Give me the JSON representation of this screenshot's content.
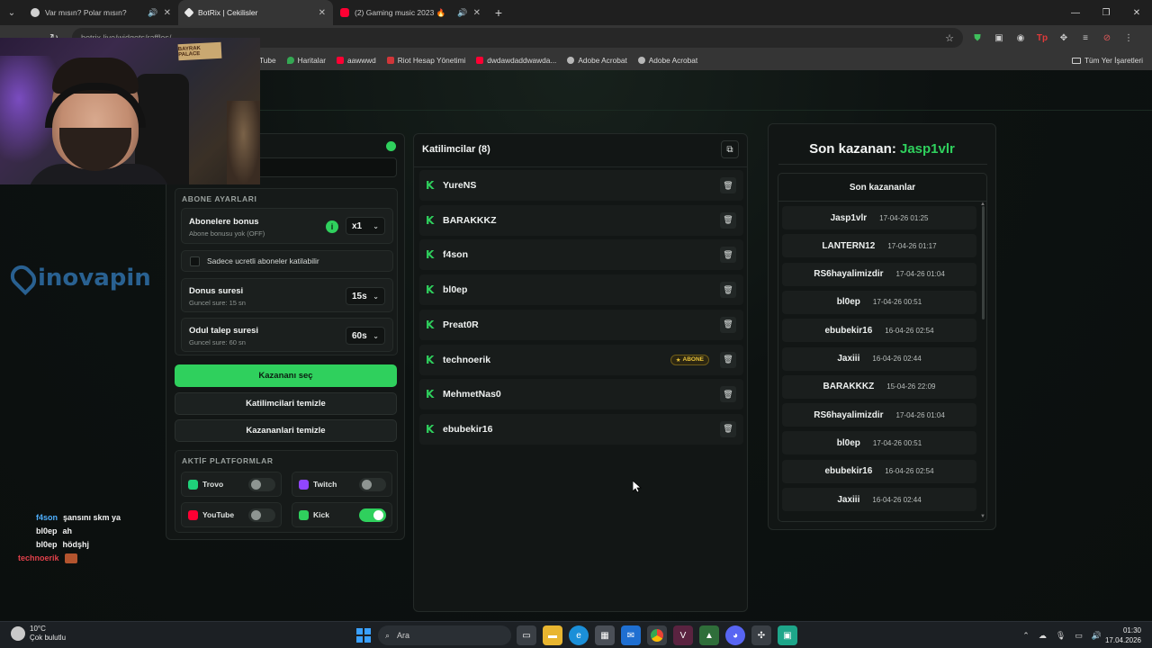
{
  "browser": {
    "tabs": [
      {
        "title": "Var mısın? Polar mısın?",
        "active": false,
        "favicon_color": "#d0d0d0"
      },
      {
        "title": "BotRix | Cekilisler",
        "active": true,
        "favicon_color": "#e8e8e8"
      },
      {
        "title": "(2) Gaming music 2023 🔥",
        "active": false,
        "favicon_color": "#ff0033"
      }
    ],
    "new_tab_icon": "+",
    "url": "botrix.live/widgets/raffles/",
    "bookmarks": [
      {
        "label": "YouTube",
        "icon_color": "#ff0033"
      },
      {
        "label": "Haritalar",
        "icon_color": "#34a853"
      },
      {
        "label": "aawwwd",
        "icon_color": "#ff0033"
      },
      {
        "label": "Riot Hesap Yönetimi",
        "icon_color": "#d13639"
      },
      {
        "label": "dwdawdaddwawda...",
        "icon_color": "#ff0033"
      },
      {
        "label": "Adobe Acrobat",
        "icon_color": "#b7b7b7"
      },
      {
        "label": "Adobe Acrobat",
        "icon_color": "#b7b7b7"
      }
    ],
    "all_bookmarks": "Tüm Yer İşaretleri"
  },
  "settings": {
    "subscriber_section": {
      "title": "ABONE AYARLARI",
      "bonus_title": "Abonelere bonus",
      "bonus_sub": "Abone bonusu yok (OFF)",
      "bonus_value": "x1",
      "only_paid_label": "Sadece ucretli aboneler katilabilir",
      "duration_title": "Donus suresi",
      "duration_sub": "Guncel sure: 15 sn",
      "duration_value": "15s",
      "claim_title": "Odul talep suresi",
      "claim_sub": "Guncel sure: 60 sn",
      "claim_value": "60s"
    },
    "buttons": {
      "pick_winner": "Kazananı seç",
      "clear_participants": "Katilimcilari temizle",
      "clear_winners": "Kazananlari temizle"
    },
    "platforms": {
      "title": "AKTİF PLATFORMLAR",
      "items": [
        {
          "name": "Trovo",
          "enabled": false,
          "color": "#1fd17a"
        },
        {
          "name": "Twitch",
          "enabled": false,
          "color": "#9146ff"
        },
        {
          "name": "YouTube",
          "enabled": false,
          "color": "#ff0033"
        },
        {
          "name": "Kick",
          "enabled": true,
          "color": "#2fd05d"
        }
      ]
    }
  },
  "participants": {
    "header": "Katilimcilar (8)",
    "badge_label": "ABONE",
    "items": [
      {
        "name": "YureNS",
        "subscriber": false
      },
      {
        "name": "BARAKKKZ",
        "subscriber": false
      },
      {
        "name": "f4son",
        "subscriber": false
      },
      {
        "name": "bl0ep",
        "subscriber": false
      },
      {
        "name": "Preat0R",
        "subscriber": false
      },
      {
        "name": "technoerik",
        "subscriber": true
      },
      {
        "name": "MehmetNas0",
        "subscriber": false
      },
      {
        "name": "ebubekir16",
        "subscriber": false
      }
    ]
  },
  "winners": {
    "title_prefix": "Son kazanan:",
    "current_winner": "Jasp1vlr",
    "list_title": "Son kazananlar",
    "items": [
      {
        "name": "Jasp1vlr",
        "date": "17-04-26 01:25"
      },
      {
        "name": "LANTERN12",
        "date": "17-04-26 01:17"
      },
      {
        "name": "RS6hayalimizdir",
        "date": "17-04-26 01:04"
      },
      {
        "name": "bl0ep",
        "date": "17-04-26 00:51"
      },
      {
        "name": "ebubekir16",
        "date": "16-04-26 02:54"
      },
      {
        "name": "Jaxiii",
        "date": "16-04-26 02:44"
      },
      {
        "name": "BARAKKKZ",
        "date": "15-04-26 22:09"
      },
      {
        "name": "RS6hayalimizdir",
        "date": "17-04-26 01:04"
      },
      {
        "name": "bl0ep",
        "date": "17-04-26 00:51"
      },
      {
        "name": "ebubekir16",
        "date": "16-04-26 02:54"
      },
      {
        "name": "Jaxiii",
        "date": "16-04-26 02:44"
      }
    ]
  },
  "overlay": {
    "webcam_sign": "BAYRAK PALACE",
    "logo_text": "inovapin",
    "chat": [
      {
        "user": "f4son",
        "message": "şansını skm ya"
      },
      {
        "user": "bl0ep",
        "message": "ah"
      },
      {
        "user": "bl0ep",
        "message": "hödşhj"
      },
      {
        "user": "technoerik",
        "message": ""
      }
    ]
  },
  "taskbar": {
    "temperature": "10°C",
    "weather": "Çok bulutlu",
    "search_label": "Ara",
    "time": "01:30",
    "date": "17.04.2026"
  },
  "colors": {
    "accent": "#2fd05d",
    "panel_bg": "#121615",
    "page_bg": "#0d1110"
  }
}
